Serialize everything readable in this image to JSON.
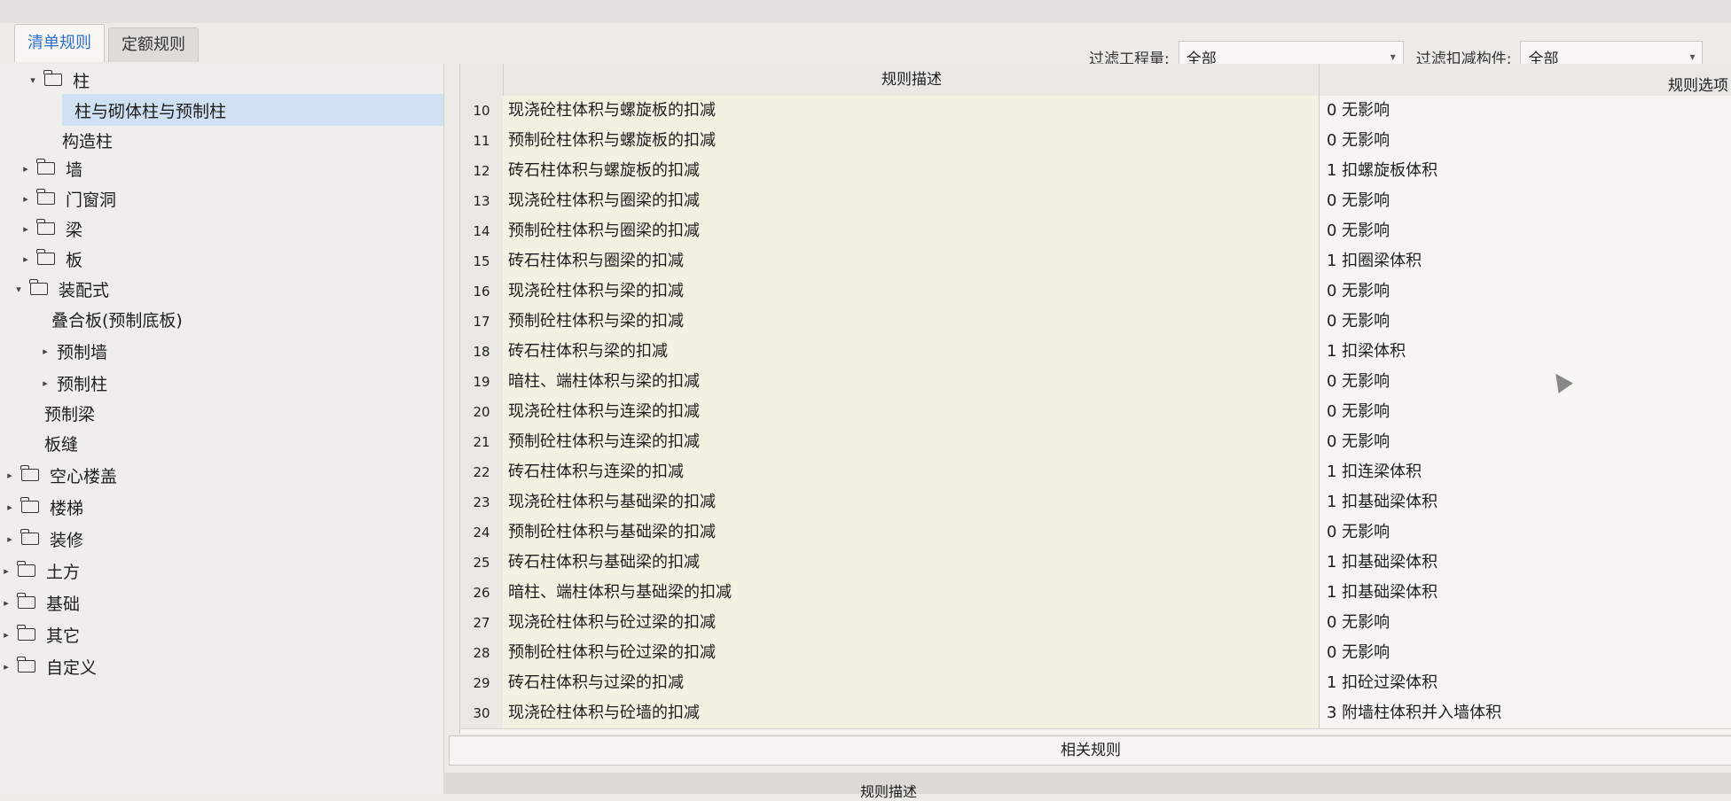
{
  "tabs": [
    "清单规则",
    "定额规则"
  ],
  "filters": {
    "quantity_label": "过滤工程量:",
    "quantity_value": "全部",
    "component_label": "过滤扣减构件:",
    "component_value": "全部"
  },
  "tree": [
    {
      "label": "柱",
      "toggle": "▾",
      "folder": true
    },
    {
      "label": "柱与砌体柱与预制柱",
      "toggle": "",
      "folder": false
    },
    {
      "label": "构造柱",
      "toggle": "",
      "folder": false
    },
    {
      "label": "墙",
      "toggle": "▸",
      "folder": true
    },
    {
      "label": "门窗洞",
      "toggle": "▸",
      "folder": true
    },
    {
      "label": "梁",
      "toggle": "▸",
      "folder": true
    },
    {
      "label": "板",
      "toggle": "▸",
      "folder": true
    },
    {
      "label": "装配式",
      "toggle": "▾",
      "folder": true
    },
    {
      "label": "叠合板(预制底板)",
      "toggle": "",
      "folder": false
    },
    {
      "label": "预制墙",
      "toggle": "▸",
      "folder": false
    },
    {
      "label": "预制柱",
      "toggle": "▸",
      "folder": false
    },
    {
      "label": "预制梁",
      "toggle": "",
      "folder": false
    },
    {
      "label": "板缝",
      "toggle": "",
      "folder": false
    },
    {
      "label": "空心楼盖",
      "toggle": "▸",
      "folder": true
    },
    {
      "label": "楼梯",
      "toggle": "▸",
      "folder": true
    },
    {
      "label": "装修",
      "toggle": "▸",
      "folder": true
    },
    {
      "label": "土方",
      "toggle": "▸",
      "folder": true
    },
    {
      "label": "基础",
      "toggle": "▸",
      "folder": true
    },
    {
      "label": "其它",
      "toggle": "▸",
      "folder": true
    },
    {
      "label": "自定义",
      "toggle": "▸",
      "folder": true
    }
  ],
  "table": {
    "col_desc": "规则描述",
    "col_option": "规则选项",
    "rows": [
      {
        "num": "10",
        "desc": "现浇砼柱体积与螺旋板的扣减",
        "option": "0  无影响"
      },
      {
        "num": "11",
        "desc": "预制砼柱体积与螺旋板的扣减",
        "option": "0  无影响"
      },
      {
        "num": "12",
        "desc": "砖石柱体积与螺旋板的扣减",
        "option": "1  扣螺旋板体积"
      },
      {
        "num": "13",
        "desc": "现浇砼柱体积与圈梁的扣减",
        "option": "0  无影响"
      },
      {
        "num": "14",
        "desc": "预制砼柱体积与圈梁的扣减",
        "option": "0  无影响"
      },
      {
        "num": "15",
        "desc": "砖石柱体积与圈梁的扣减",
        "option": "1  扣圈梁体积"
      },
      {
        "num": "16",
        "desc": "现浇砼柱体积与梁的扣减",
        "option": "0  无影响"
      },
      {
        "num": "17",
        "desc": "预制砼柱体积与梁的扣减",
        "option": "0  无影响"
      },
      {
        "num": "18",
        "desc": "砖石柱体积与梁的扣减",
        "option": "1  扣梁体积"
      },
      {
        "num": "19",
        "desc": "暗柱、端柱体积与梁的扣减",
        "option": "0  无影响"
      },
      {
        "num": "20",
        "desc": "现浇砼柱体积与连梁的扣减",
        "option": "0  无影响"
      },
      {
        "num": "21",
        "desc": "预制砼柱体积与连梁的扣减",
        "option": "0  无影响"
      },
      {
        "num": "22",
        "desc": "砖石柱体积与连梁的扣减",
        "option": "1  扣连梁体积"
      },
      {
        "num": "23",
        "desc": "现浇砼柱体积与基础梁的扣减",
        "option": "1  扣基础梁体积"
      },
      {
        "num": "24",
        "desc": "预制砼柱体积与基础梁的扣减",
        "option": "0  无影响"
      },
      {
        "num": "25",
        "desc": "砖石柱体积与基础梁的扣减",
        "option": "1  扣基础梁体积"
      },
      {
        "num": "26",
        "desc": "暗柱、端柱体积与基础梁的扣减",
        "option": "1  扣基础梁体积"
      },
      {
        "num": "27",
        "desc": "现浇砼柱体积与砼过梁的扣减",
        "option": "0  无影响"
      },
      {
        "num": "28",
        "desc": "预制砼柱体积与砼过梁的扣减",
        "option": "0  无影响"
      },
      {
        "num": "29",
        "desc": "砖石柱体积与过梁的扣减",
        "option": "1  扣砼过梁体积"
      },
      {
        "num": "30",
        "desc": "现浇砼柱体积与砼墙的扣减",
        "option": "3  附墙柱体积并入墙体积"
      }
    ]
  },
  "related_rules_label": "相关规则",
  "bottom_label": "规则描述"
}
